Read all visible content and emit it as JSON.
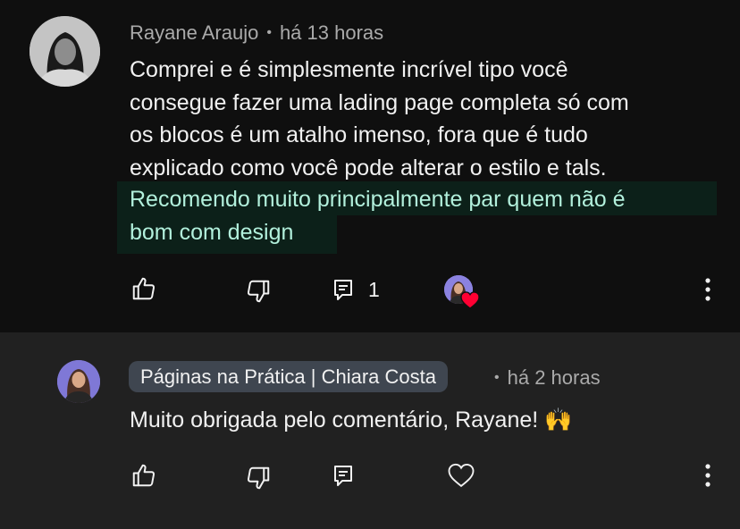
{
  "comments": [
    {
      "author": "Rayane Araujo",
      "separator": "•",
      "time": "há 13 horas",
      "text_lines": [
        "Comprei e é simplesmente incrível tipo você",
        "consegue fazer uma lading page completa só com",
        "os blocos é um atalho imenso, fora que é tudo",
        "explicado como você pode alterar o estilo e tals."
      ],
      "highlighted_lines": [
        "Recomendo muito principalmente par quem não é",
        "bom com design"
      ],
      "reply_count": "1",
      "creator_hearted": true,
      "icons": [
        "thumbs-up-icon",
        "thumbs-down-icon",
        "reply-icon",
        "more-icon"
      ]
    },
    {
      "author": "Páginas na Prática | Chiara Costa",
      "separator": "•",
      "time": "há 2 horas",
      "text": "Muito obrigada pelo comentário, Rayane! 🙌",
      "icons": [
        "thumbs-up-icon",
        "thumbs-down-icon",
        "reply-icon",
        "heart-icon",
        "more-icon"
      ]
    }
  ],
  "colors": {
    "background": "#0f0f0f",
    "reply_background": "#212121",
    "highlight_background": "#0c2019",
    "highlight_text": "#b2f0dc",
    "meta_text": "#aaaaaa",
    "heart_red": "#ff0033",
    "chip_background": "#3f4650"
  }
}
